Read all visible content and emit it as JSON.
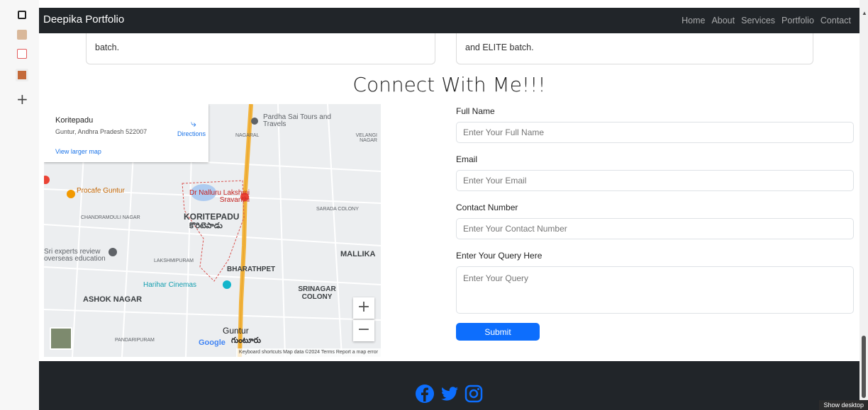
{
  "navbar": {
    "brand": "Deepika Portfolio",
    "links": [
      "Home",
      "About",
      "Services",
      "Portfolio",
      "Contact"
    ]
  },
  "cards": {
    "left_text": "batch.",
    "right_text": "and ELITE batch."
  },
  "section": {
    "title": "Connect With Me!!!"
  },
  "map": {
    "place_name": "Koritepadu",
    "address": "Guntur, Andhra Pradesh 522007",
    "directions_label": "Directions",
    "larger_map_link": "View larger map",
    "zoom_in": "+",
    "zoom_out": "−",
    "footer_text": "Keyboard shortcuts   Map data ©2024   Terms   Report a map error",
    "google_logo": "Google",
    "labels": {
      "tours": "Pardha Sai Tours and Travels",
      "procafe": "Procafe Guntur",
      "nalluru": "Dr Nalluru Lakshmi Sravanthi",
      "koritepadu": "KORITEPADU",
      "koritepadu_te": "కొరిటెపాడు",
      "chandramouli": "CHANDRAMOULI NAGAR",
      "sarada": "SARADA COLONY",
      "sri_experts": "Sri experts review overseas education",
      "lakshmipuram": "LAKSHMIPURAM",
      "bharathpet": "BHARATHPET",
      "mallika": "MALLIKA",
      "harihar": "Harihar Cinemas",
      "srinagar": "SRINAGAR COLONY",
      "ashok": "ASHOK NAGAR",
      "guntur": "Guntur",
      "guntur_te": "గుంటూరు",
      "pandaripuram": "PANDARIPURAM",
      "nagaral": "NAGARAL",
      "velangi": "VELANGI NAGAR"
    }
  },
  "form": {
    "full_name_label": "Full Name",
    "full_name_placeholder": "Enter Your Full Name",
    "email_label": "Email",
    "email_placeholder": "Enter Your Email",
    "contact_label": "Contact Number",
    "contact_placeholder": "Enter Your Contact Number",
    "query_label": "Enter Your Query Here",
    "query_placeholder": "Enter Your Query",
    "submit_label": "Submit"
  },
  "footer": {
    "social_icons": [
      "facebook-icon",
      "twitter-icon",
      "instagram-icon"
    ],
    "icon_color": "#0d6efd"
  },
  "system": {
    "show_desktop": "Show desktop"
  }
}
